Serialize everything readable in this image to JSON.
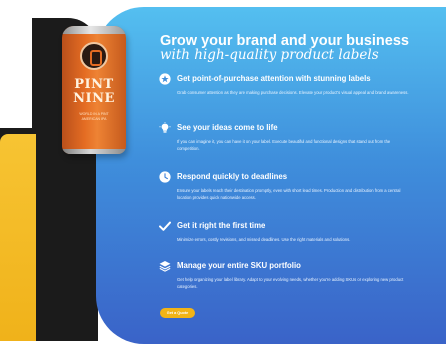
{
  "can": {
    "title_line1": "PINT",
    "title_line2": "NINE",
    "sub_line1": "WORLD IN A PINT",
    "sub_line2": "AMERICAN IPA"
  },
  "headline": {
    "line1": "Grow your brand and your business",
    "line2": "with high-quality product labels"
  },
  "features": [
    {
      "icon": "award-star-icon",
      "title": "Get point-of-purchase attention with stunning labels",
      "desc": "Grab consumer attention as they are making purchase decisions. Elevate your product's visual appeal and brand awareness."
    },
    {
      "icon": "lightbulb-icon",
      "title": "See your ideas come to life",
      "desc": "If you can imagine it, you can have it on your label. Execute beautiful and functional designs that stand out from the competition."
    },
    {
      "icon": "clock-icon",
      "title": "Respond quickly to deadlines",
      "desc": "Ensure your labels reach their destination promptly, even with short lead times. Production and distribution from a central location provides quick nationwide access."
    },
    {
      "icon": "checkmark-icon",
      "title": "Get it right the first time",
      "desc": "Minimize errors, costly revisions, and missed deadlines. Use the right materials and solutions."
    },
    {
      "icon": "layers-icon",
      "title": "Manage your entire SKU portfolio",
      "desc": "Get help organizing your label library. Adapt to your evolving needs, whether you're adding SKUs or exploring new product categories."
    }
  ],
  "cta_label": "Get a Quote",
  "colors": {
    "accent": "#f2b416",
    "panel_top": "#54bff0",
    "panel_bottom": "#3a63c8",
    "dark_shape": "#1b1b1b"
  }
}
